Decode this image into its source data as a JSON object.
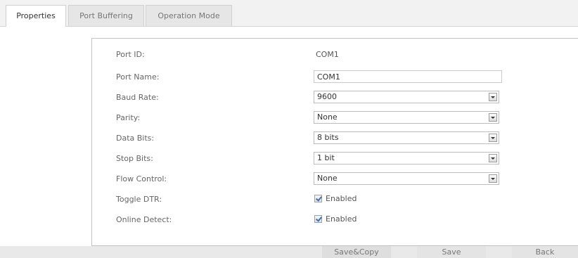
{
  "tabs": [
    {
      "label": "Properties",
      "active": true
    },
    {
      "label": "Port Buffering",
      "active": false
    },
    {
      "label": "Operation Mode",
      "active": false
    }
  ],
  "form": {
    "port_id": {
      "label": "Port ID:",
      "value": "COM1"
    },
    "port_name": {
      "label": "Port Name:",
      "value": "COM1"
    },
    "baud_rate": {
      "label": "Baud Rate:",
      "value": "9600"
    },
    "parity": {
      "label": "Parity:",
      "value": "None"
    },
    "data_bits": {
      "label": "Data Bits:",
      "value": "8 bits"
    },
    "stop_bits": {
      "label": "Stop Bits:",
      "value": "1 bit"
    },
    "flow_control": {
      "label": "Flow Control:",
      "value": "None"
    },
    "toggle_dtr": {
      "label": "Toggle DTR:",
      "checkbox_label": "Enabled",
      "checked": true
    },
    "online_detect": {
      "label": "Online Detect:",
      "checkbox_label": "Enabled",
      "checked": true
    }
  },
  "footer": {
    "save_copy_label": "Save&Copy",
    "save_label": "Save",
    "back_label": "Back"
  }
}
